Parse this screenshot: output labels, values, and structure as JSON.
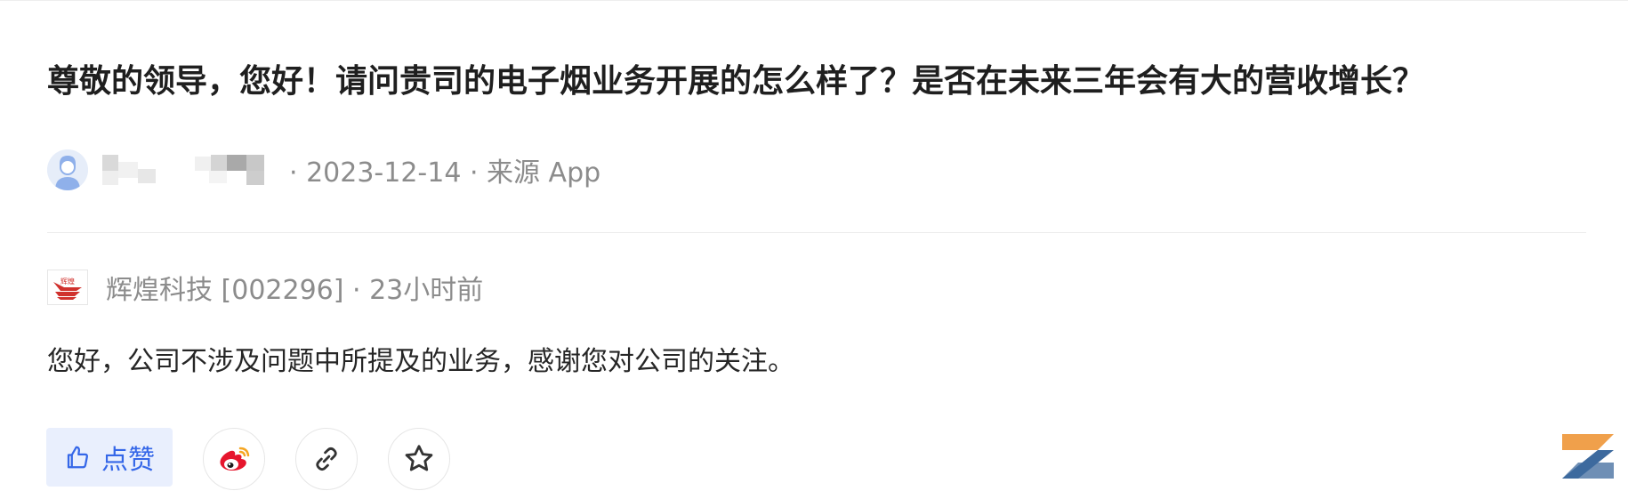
{
  "question": {
    "title": "尊敬的领导，您好！请问贵司的电子烟业务开展的怎么样了？是否在未来三年会有大的营收增长？",
    "meta": "· 2023-12-14 · 来源 App"
  },
  "answer": {
    "company_meta": "辉煌科技 [002296] · 23小时前",
    "logo_text": "辉煌",
    "body": "您好，公司不涉及问题中所提及的业务，感谢您对公司的关注。"
  },
  "actions": {
    "like_label": "点赞",
    "icons": [
      "thumbs-up-icon",
      "weibo-icon",
      "link-icon",
      "star-icon"
    ]
  },
  "colors": {
    "accent": "#3567e8",
    "like_bg": "#e9effd",
    "muted_text": "#8c8c8c",
    "logo_red": "#d0312d"
  }
}
